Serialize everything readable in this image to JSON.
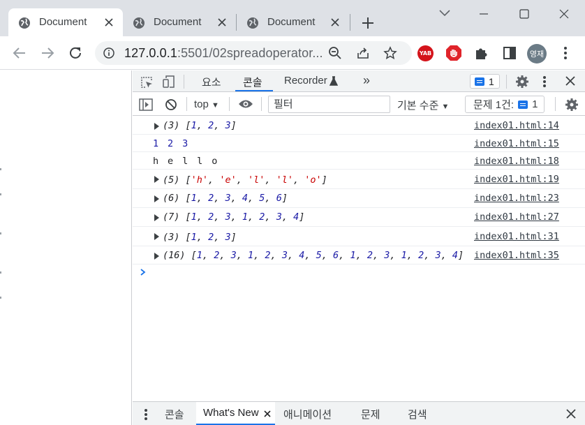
{
  "browser": {
    "tabs": [
      {
        "title": "Document",
        "active": true
      },
      {
        "title": "Document",
        "active": false
      },
      {
        "title": "Document",
        "active": false
      }
    ],
    "url_host": "127.0.0.1",
    "url_path": ":5501/02spreadoperator...",
    "extensions": [
      {
        "name": "yab-extension-icon",
        "label": "YAB"
      },
      {
        "name": "adblock-icon"
      },
      {
        "name": "puzzle-icon"
      },
      {
        "name": "side-panel-icon"
      }
    ],
    "profile_initial": "영재"
  },
  "devtools": {
    "tabs": [
      "요소",
      "콘솔",
      "Recorder"
    ],
    "active_tab": "콘솔",
    "more_tabs": "»",
    "issues_badge_count": "1",
    "context": "top",
    "filter_placeholder": "필터",
    "levels_label": "기본 수준",
    "issues_label": "문제 1건:",
    "issues_count": "1"
  },
  "console": {
    "messages": [
      {
        "expandable": true,
        "prefix": "(3) ",
        "parts": [
          [
            "p",
            "["
          ],
          [
            "n",
            "1"
          ],
          [
            "p",
            ", "
          ],
          [
            "n",
            "2"
          ],
          [
            "p",
            ", "
          ],
          [
            "n",
            "3"
          ],
          [
            "p",
            "]"
          ]
        ],
        "source": "index01.html:14"
      },
      {
        "expandable": false,
        "plain": "1 2 3",
        "plain_color": "#1a1aa6",
        "source": "index01.html:15"
      },
      {
        "expandable": false,
        "plain": "h e l l o",
        "plain_color": "#202124",
        "source": "index01.html:18"
      },
      {
        "expandable": true,
        "prefix": "(5) ",
        "parts": [
          [
            "p",
            "["
          ],
          [
            "s",
            "'h'"
          ],
          [
            "p",
            ", "
          ],
          [
            "s",
            "'e'"
          ],
          [
            "p",
            ", "
          ],
          [
            "s",
            "'l'"
          ],
          [
            "p",
            ", "
          ],
          [
            "s",
            "'l'"
          ],
          [
            "p",
            ", "
          ],
          [
            "s",
            "'o'"
          ],
          [
            "p",
            "]"
          ]
        ],
        "source": "index01.html:19"
      },
      {
        "expandable": true,
        "prefix": "(6) ",
        "parts": [
          [
            "p",
            "["
          ],
          [
            "n",
            "1"
          ],
          [
            "p",
            ", "
          ],
          [
            "n",
            "2"
          ],
          [
            "p",
            ", "
          ],
          [
            "n",
            "3"
          ],
          [
            "p",
            ", "
          ],
          [
            "n",
            "4"
          ],
          [
            "p",
            ", "
          ],
          [
            "n",
            "5"
          ],
          [
            "p",
            ", "
          ],
          [
            "n",
            "6"
          ],
          [
            "p",
            "]"
          ]
        ],
        "source": "index01.html:23"
      },
      {
        "expandable": true,
        "prefix": "(7) ",
        "parts": [
          [
            "p",
            "["
          ],
          [
            "n",
            "1"
          ],
          [
            "p",
            ", "
          ],
          [
            "n",
            "2"
          ],
          [
            "p",
            ", "
          ],
          [
            "n",
            "3"
          ],
          [
            "p",
            ", "
          ],
          [
            "n",
            "1"
          ],
          [
            "p",
            ", "
          ],
          [
            "n",
            "2"
          ],
          [
            "p",
            ", "
          ],
          [
            "n",
            "3"
          ],
          [
            "p",
            ", "
          ],
          [
            "n",
            "4"
          ],
          [
            "p",
            "]"
          ]
        ],
        "source": "index01.html:27"
      },
      {
        "expandable": true,
        "prefix": "(3) ",
        "parts": [
          [
            "p",
            "["
          ],
          [
            "n",
            "1"
          ],
          [
            "p",
            ", "
          ],
          [
            "n",
            "2"
          ],
          [
            "p",
            ", "
          ],
          [
            "n",
            "3"
          ],
          [
            "p",
            "]"
          ]
        ],
        "source": "index01.html:31"
      },
      {
        "expandable": true,
        "prefix": "(16) ",
        "parts": [
          [
            "p",
            "["
          ],
          [
            "n",
            "1"
          ],
          [
            "p",
            ", "
          ],
          [
            "n",
            "2"
          ],
          [
            "p",
            ", "
          ],
          [
            "n",
            "3"
          ],
          [
            "p",
            ", "
          ],
          [
            "n",
            "1"
          ],
          [
            "p",
            ", "
          ],
          [
            "n",
            "2"
          ],
          [
            "p",
            ", "
          ],
          [
            "n",
            "3"
          ],
          [
            "p",
            ", "
          ],
          [
            "n",
            "4"
          ],
          [
            "p",
            ", "
          ],
          [
            "n",
            "5"
          ],
          [
            "p",
            ", "
          ],
          [
            "n",
            "6"
          ],
          [
            "p",
            ", "
          ],
          [
            "n",
            "1"
          ],
          [
            "p",
            ", "
          ],
          [
            "n",
            "2"
          ],
          [
            "p",
            ", "
          ],
          [
            "n",
            "3"
          ],
          [
            "p",
            ", "
          ],
          [
            "n",
            "1"
          ],
          [
            "p",
            ", "
          ],
          [
            "n",
            "2"
          ],
          [
            "p",
            ", "
          ],
          [
            "n",
            "3"
          ],
          [
            "p",
            ", "
          ],
          [
            "n",
            "4"
          ],
          [
            "p",
            "]"
          ]
        ],
        "source": "index01.html:35"
      }
    ]
  },
  "drawer": {
    "tabs": [
      "콘솔",
      "What's New",
      "애니메이션",
      "문제",
      "검색"
    ],
    "active_tab": "What's New"
  },
  "colors": {
    "accent": "#1a73e8",
    "number": "#1a1aa6",
    "string": "#c80000"
  }
}
